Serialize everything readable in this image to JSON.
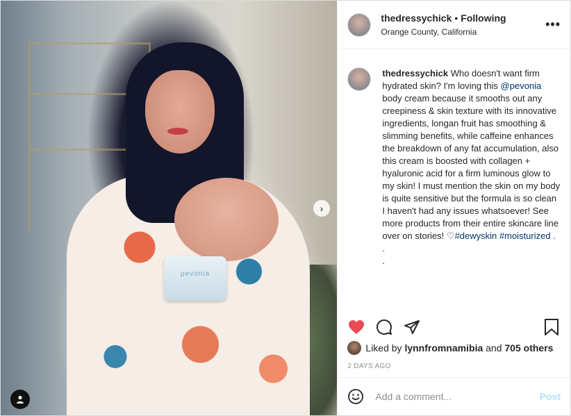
{
  "post": {
    "username": "thedressychick",
    "follow_status": "Following",
    "location": "Orange County, California",
    "more_label": "•••",
    "jar_label": "pevonia"
  },
  "caption": {
    "username": "thedressychick",
    "text_1": " Who doesn't want firm hydrated skin? I'm loving this ",
    "mention": "@pevonia",
    "text_2": " body cream because it smooths out any creepiness & skin texture with its innovative ingredients, longan fruit has smoothing & slimming benefits, while caffeine enhances the breakdown of any fat accumulation, also this cream is boosted with collagen + hyaluronic acid for a firm luminous glow to my skin! I must mention the skin on my body is quite sensitive but the formula is so clean I haven't had any issues whatsoever! See more products from their entire skincare line over on stories! ",
    "heart": "♡",
    "hashtag_1": "#dewyskin",
    "hashtag_2": "#moisturized",
    "end": " .",
    "dot_1": ".",
    "dot_2": "."
  },
  "likes": {
    "prefix": "Liked by ",
    "user": "lynnfromnamibia",
    "middle": " and ",
    "others": "705 others"
  },
  "time_ago": "2 DAYS AGO",
  "comment": {
    "placeholder": "Add a comment...",
    "post_label": "Post"
  },
  "colors": {
    "liked_heart": "#ed4956",
    "link": "#00376b",
    "post_button_disabled": "#b2dffc"
  },
  "icons": [
    "heart-icon",
    "comment-icon",
    "share-icon",
    "bookmark-icon",
    "smiley-icon",
    "tag-user-icon",
    "chevron-right-icon",
    "more-icon"
  ]
}
